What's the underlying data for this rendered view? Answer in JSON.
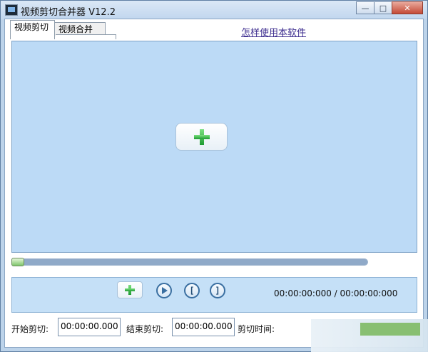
{
  "window": {
    "title": "视频剪切合并器 V12.2",
    "minimize": "—",
    "maximize": "□",
    "close": "✕"
  },
  "tabs": [
    {
      "label": "视频剪切",
      "active": true
    },
    {
      "label": "视频合并",
      "active": false
    }
  ],
  "help_link": "怎样使用本软件",
  "icons": {
    "app": "video-editor-icon",
    "add": "plus-icon",
    "play": "play-icon",
    "mark_in": "bracket-left-icon",
    "mark_out": "bracket-right-icon"
  },
  "controls": {
    "add_label": "",
    "mark_in_glyph": "[",
    "mark_out_glyph": "]",
    "timecode": "00:00:00:000 / 00:00:00:000"
  },
  "progress": {
    "value_percent": 0
  },
  "fields": {
    "start_label": "开始剪切:",
    "start_value": "00:00:00.000",
    "end_label": "结束剪切:",
    "end_value": "00:00:00.000",
    "duration_label": "剪切时间:"
  },
  "colors": {
    "panel_bg": "#bcdaf6",
    "accent_green": "#1e9b32",
    "link": "#3d2d8f"
  }
}
